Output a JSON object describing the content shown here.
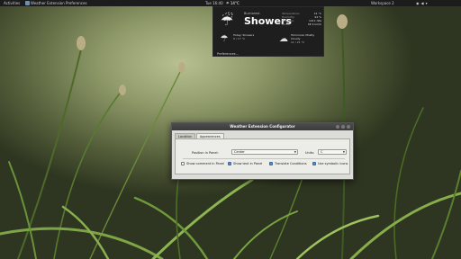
{
  "panel": {
    "activities": "Activities",
    "window_title": "Weather Extension Preferences",
    "clock": "Tue 16:40",
    "weather_temp": "14°C",
    "workspace": "Workspace 2",
    "tray_icons": [
      "network-icon",
      "volume-icon",
      "user-menu-icon"
    ]
  },
  "weather": {
    "location": "Bucharest",
    "condition": "Showers",
    "icon": "rain-cloud-icon",
    "details": [
      {
        "key": "Temperature:",
        "value": "14 °C"
      },
      {
        "key": "Humidity:",
        "value": "94 %"
      },
      {
        "key": "Pressure:",
        "value": "1011 hPa"
      },
      {
        "key": "Wind:",
        "value": "SE 4 km/h"
      }
    ],
    "forecast": [
      {
        "day": "Today: Showers",
        "temp": "9 / 17 °C",
        "icon": "rain-cloud-icon"
      },
      {
        "day": "Tomorrow: Mostly Cloudy",
        "temp": "11 / 21 °C",
        "icon": "partly-cloudy-icon"
      }
    ],
    "preferences": "Preferences..."
  },
  "dialog": {
    "title": "Weather Extension Configurator",
    "tabs": [
      "Location",
      "Appearances"
    ],
    "position_label": "Position in Panel:",
    "position_value": "Center",
    "units_label": "Units:",
    "units_value": "C",
    "checkboxes": [
      {
        "label": "Show comment in Panel",
        "checked": false
      },
      {
        "label": "Show text in Panel",
        "checked": true
      },
      {
        "label": "Translate Conditions",
        "checked": true
      },
      {
        "label": "Use symbolic icons",
        "checked": true
      }
    ]
  }
}
